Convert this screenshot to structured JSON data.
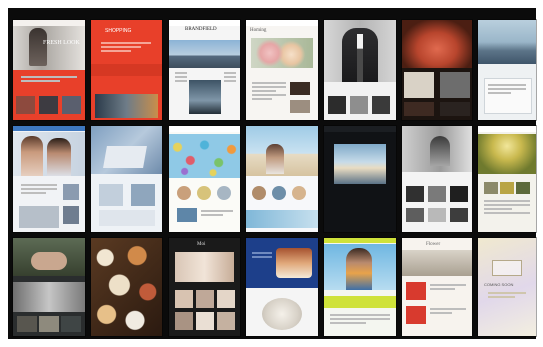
{
  "gallery": {
    "tiles": [
      {
        "theme": "red-fashion",
        "title": "FRESH LOOK",
        "accent": "#e8402a"
      },
      {
        "theme": "red-brand",
        "title": "SHOPPING",
        "accent": "#e8402a"
      },
      {
        "theme": "city-skyline",
        "title": "BRANDFIELD",
        "accent": "#5b7fa8"
      },
      {
        "theme": "flowers",
        "title": "Homing",
        "accent": "#c9a27a"
      },
      {
        "theme": "suit",
        "title": "",
        "accent": "#3a3a3a"
      },
      {
        "theme": "food-dark",
        "title": "",
        "accent": "#6b2a18"
      },
      {
        "theme": "seascape",
        "title": "",
        "accent": "#8aa3b5"
      },
      {
        "theme": "women-portrait",
        "title": "",
        "accent": "#3e78c0"
      },
      {
        "theme": "laptop-blue",
        "title": "",
        "accent": "#6e92b6"
      },
      {
        "theme": "confetti",
        "title": "",
        "accent": "#e5d25c"
      },
      {
        "theme": "beach-cafe",
        "title": "",
        "accent": "#7fb7d8"
      },
      {
        "theme": "dark-sky",
        "title": "",
        "accent": "#a9c6dc"
      },
      {
        "theme": "grayscale-bw",
        "title": "",
        "accent": "#777777"
      },
      {
        "theme": "golden-forest",
        "title": "",
        "accent": "#b9a544"
      },
      {
        "theme": "hands-dark",
        "title": "",
        "accent": "#3b4a3a"
      },
      {
        "theme": "food-table",
        "title": "",
        "accent": "#8a5a32"
      },
      {
        "theme": "nails",
        "title": "Moi",
        "accent": "#cbb7a6"
      },
      {
        "theme": "cake-blue",
        "title": "",
        "accent": "#1d3f8a"
      },
      {
        "theme": "man-lime",
        "title": "",
        "accent": "#cfe23a"
      },
      {
        "theme": "red-wedding",
        "title": "Flower",
        "accent": "#d83a2e"
      },
      {
        "theme": "pastel-coming-soon",
        "title": "COMING SOON",
        "accent": "#e8dfc0"
      }
    ]
  }
}
